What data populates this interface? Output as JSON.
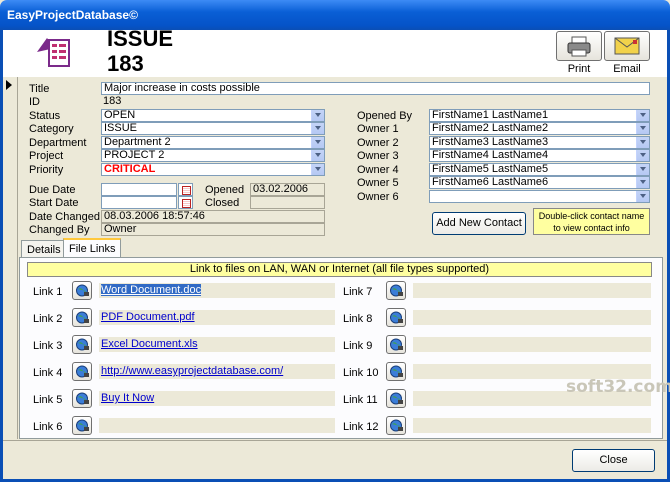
{
  "window": {
    "title": "EasyProjectDatabase©"
  },
  "header": {
    "issue_label": "ISSUE",
    "issue_number": "183",
    "print_label": "Print",
    "email_label": "Email"
  },
  "fields": {
    "title_label": "Title",
    "title_value": "Major increase in costs possible",
    "id_label": "ID",
    "id_value": "183",
    "status_label": "Status",
    "status_value": "OPEN",
    "category_label": "Category",
    "category_value": "ISSUE",
    "department_label": "Department",
    "department_value": "Department 2",
    "project_label": "Project",
    "project_value": "PROJECT 2",
    "priority_label": "Priority",
    "priority_value": "CRITICAL",
    "due_date_label": "Due Date",
    "due_date_value": "",
    "start_date_label": "Start Date",
    "start_date_value": "",
    "opened_label": "Opened",
    "opened_value": "03.02.2006",
    "closed_label": "Closed",
    "closed_value": "",
    "date_changed_label": "Date Changed",
    "date_changed_value": "08.03.2006 18:57:46",
    "changed_by_label": "Changed By",
    "changed_by_value": "Owner"
  },
  "contacts": {
    "opened_by_label": "Opened By",
    "opened_by_value": "FirstName1 LastName1",
    "owner1_label": "Owner 1",
    "owner1_value": "FirstName2 LastName2",
    "owner2_label": "Owner 2",
    "owner2_value": "FirstName3 LastName3",
    "owner3_label": "Owner 3",
    "owner3_value": "FirstName4 LastName4",
    "owner4_label": "Owner 4",
    "owner4_value": "FirstName5 LastName5",
    "owner5_label": "Owner 5",
    "owner5_value": "FirstName6 LastName6",
    "owner6_label": "Owner 6",
    "owner6_value": "",
    "add_button": "Add New Contact",
    "hint": "Double-click contact name to view contact info"
  },
  "tabs": {
    "details": "Details",
    "file_links": "File Links"
  },
  "links": {
    "banner": "Link to files on LAN, WAN or Internet (all file types supported)",
    "items": [
      {
        "label": "Link 1",
        "value": "Word Document.doc"
      },
      {
        "label": "Link 2",
        "value": "PDF Document.pdf"
      },
      {
        "label": "Link 3",
        "value": "Excel Document.xls"
      },
      {
        "label": "Link 4",
        "value": "http://www.easyprojectdatabase.com/"
      },
      {
        "label": "Link 5",
        "value": "Buy It Now"
      },
      {
        "label": "Link 6",
        "value": ""
      },
      {
        "label": "Link 7",
        "value": ""
      },
      {
        "label": "Link 8",
        "value": ""
      },
      {
        "label": "Link 9",
        "value": ""
      },
      {
        "label": "Link 10",
        "value": ""
      },
      {
        "label": "Link 11",
        "value": ""
      },
      {
        "label": "Link 12",
        "value": ""
      }
    ]
  },
  "footer": {
    "close_label": "Close"
  },
  "watermark": "soft32.com",
  "colors": {
    "priority": "#ff0000",
    "titlebar": "#0a5fd6",
    "hint_bg": "#ffffa0"
  }
}
